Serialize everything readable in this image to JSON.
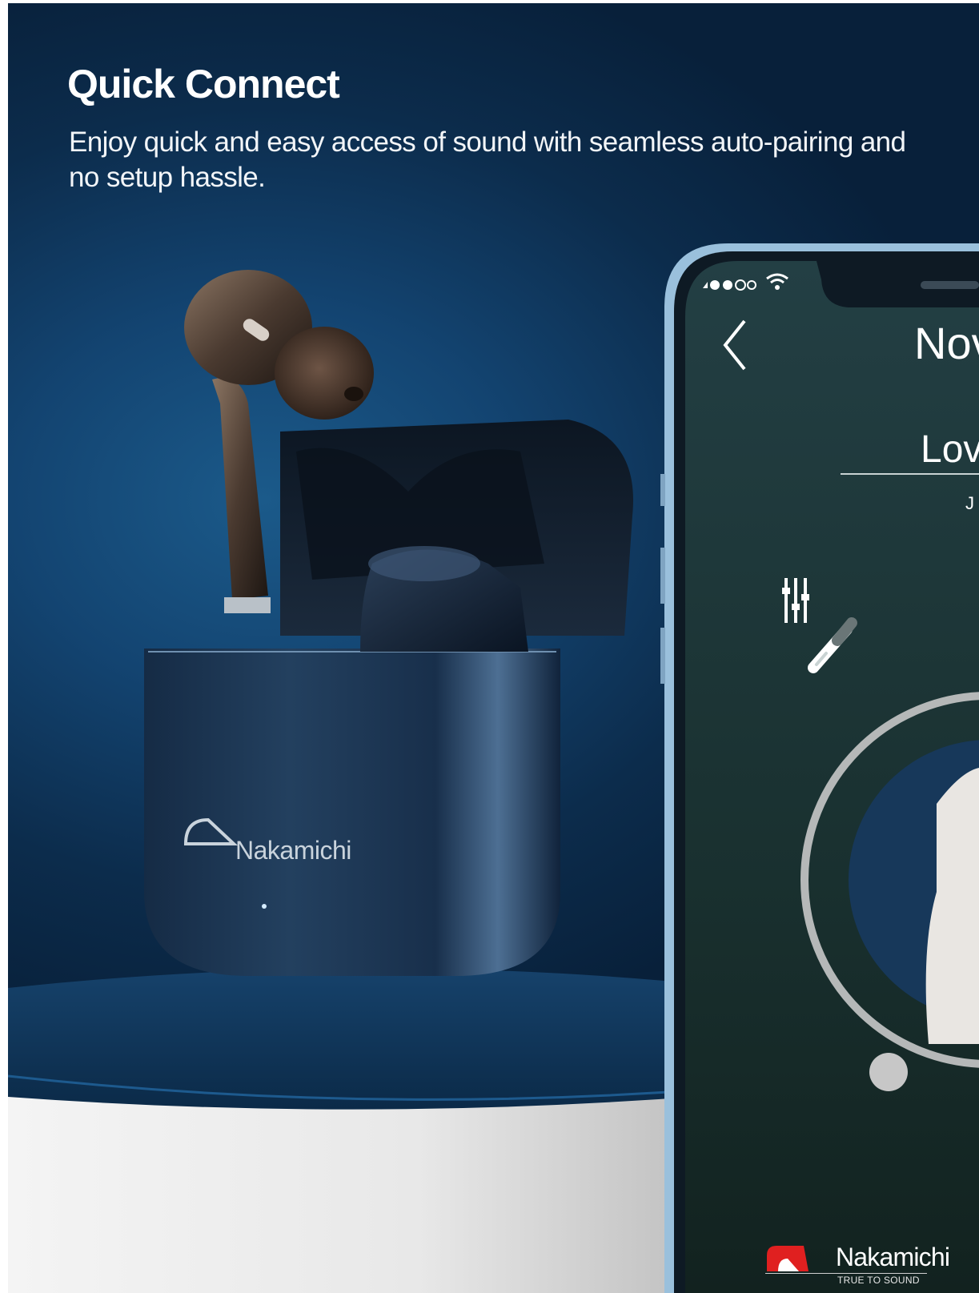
{
  "headline": "Quick Connect",
  "subheadline": "Enjoy quick and easy access of sound with seamless auto-pairing and no setup hassle.",
  "phone_screen": {
    "title_fragment": "Nov",
    "song_fragment": "Lov",
    "artist_fragment": "J",
    "icons": [
      "back-chevron-icon",
      "signal-dots-icon",
      "wifi-icon",
      "equalizer-icon",
      "earbud-icon"
    ]
  },
  "case_logo": "Nakamichi",
  "brand": {
    "name": "Nakamichi",
    "tagline": "TRUE TO SOUND",
    "accent_color": "#e02020"
  },
  "colors": {
    "background": "#0e3558",
    "pedestal_top": "#0d3152",
    "pedestal_base": "#e9e9e9",
    "phone_screen": "#1a3236"
  }
}
